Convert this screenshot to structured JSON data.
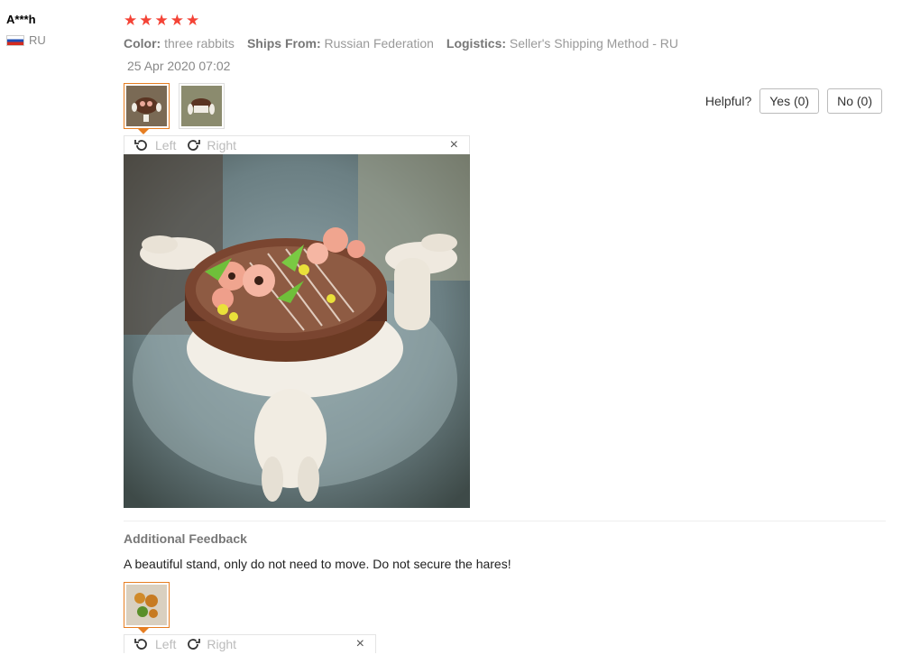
{
  "review": {
    "user_name": "A***h",
    "country": "RU",
    "rating_stars": 5,
    "meta": {
      "color_label": "Color:",
      "color_value": "three rabbits",
      "ships_label": "Ships From:",
      "ships_value": "Russian Federation",
      "logistics_label": "Logistics:",
      "logistics_value": "Seller's Shipping Method - RU"
    },
    "date": "25 Apr 2020 07:02",
    "helpful": {
      "label": "Helpful?",
      "yes": "Yes (0)",
      "no": "No (0)"
    },
    "viewer": {
      "left": "Left",
      "right": "Right",
      "close": "×"
    },
    "additional": {
      "title": "Additional Feedback",
      "text": "A beautiful stand, only do not need to move. Do not secure the hares!"
    }
  },
  "colors": {
    "star": "#f44336",
    "accent_border": "#e67e22"
  }
}
